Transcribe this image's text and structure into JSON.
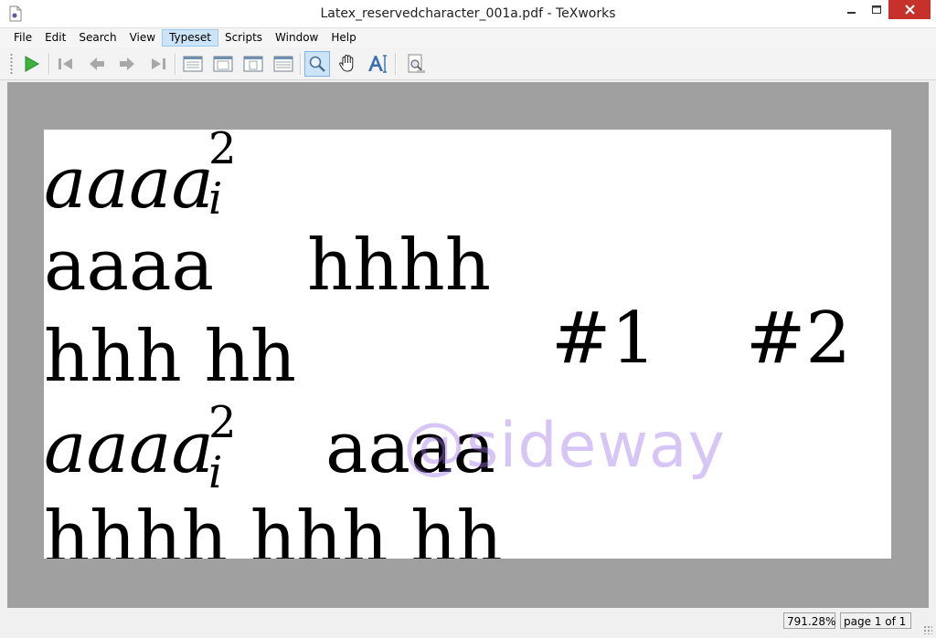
{
  "window": {
    "title": "Latex_reservedcharacter_001a.pdf - TeXworks"
  },
  "menu": {
    "items": [
      "File",
      "Edit",
      "Search",
      "View",
      "Typeset",
      "Scripts",
      "Window",
      "Help"
    ],
    "active": "Typeset"
  },
  "toolbar": {
    "buttons": [
      "typeset-play-icon",
      "first-page-icon",
      "previous-page-icon",
      "next-page-icon",
      "last-page-icon",
      "actual-size-icon",
      "fit-width-icon",
      "fit-page-icon",
      "fit-window-icon",
      "magnifier-icon",
      "hand-icon",
      "select-text-icon",
      "find-icon"
    ],
    "active_tool": "magnifier-icon"
  },
  "document": {
    "line1": {
      "base": "aaaa",
      "sup": "2",
      "sub": "i"
    },
    "line2": {
      "left": "aaaa",
      "right": "hhhh"
    },
    "line3": {
      "left": "hhh hh",
      "mid": "#1",
      "right": "#2"
    },
    "line4": {
      "base": "aaaa",
      "sup": "2",
      "sub": "i",
      "right": "aaaa"
    },
    "line5": {
      "text": "hhhh hhh hh"
    }
  },
  "watermark": "@sideway",
  "status": {
    "zoom": "791.28%",
    "page": "page 1 of 1"
  },
  "colors": {
    "accent_selection": "#cce4f7",
    "close_button": "#c7312b",
    "viewer_background": "#a0a0a0",
    "play_green": "#3db33d"
  }
}
